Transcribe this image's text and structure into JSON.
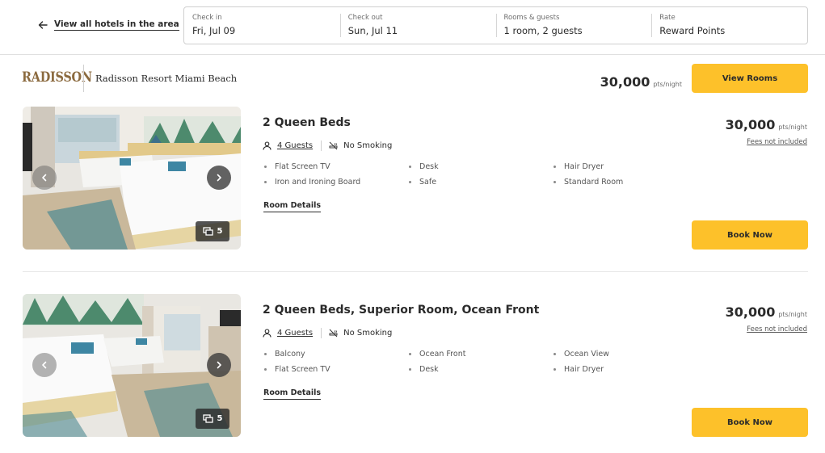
{
  "header": {
    "back_link": "View all hotels in the area",
    "search": [
      {
        "label": "Check in",
        "value": "Fri, Jul 09"
      },
      {
        "label": "Check out",
        "value": "Sun, Jul 11"
      },
      {
        "label": "Rooms & guests",
        "value": "1 room, 2 guests"
      },
      {
        "label": "Rate",
        "value": "Reward Points"
      }
    ]
  },
  "hotel": {
    "brand_logo": "RADISSON",
    "name": "Radisson Resort Miami Beach",
    "price": "30,000",
    "price_unit": "pts/night",
    "view_rooms_label": "View Rooms"
  },
  "rooms": [
    {
      "title": "2 Queen Beds",
      "guests": "4 Guests",
      "smoking": "No Smoking",
      "amenities": [
        "Flat Screen TV",
        "Desk",
        "Hair Dryer",
        "Iron and Ironing Board",
        "Safe",
        "Standard Room"
      ],
      "details_label": "Room Details",
      "price": "30,000",
      "price_unit": "pts/night",
      "fees_label": "Fees not included",
      "book_label": "Book Now",
      "photo_count": "5"
    },
    {
      "title": "2 Queen Beds, Superior Room, Ocean Front",
      "guests": "4 Guests",
      "smoking": "No Smoking",
      "amenities": [
        "Balcony",
        "Ocean Front",
        "Ocean View",
        "Flat Screen TV",
        "Desk",
        "Hair Dryer"
      ],
      "details_label": "Room Details",
      "price": "30,000",
      "price_unit": "pts/night",
      "fees_label": "Fees not included",
      "book_label": "Book Now",
      "photo_count": "5"
    }
  ],
  "colors": {
    "accent": "#fdc12a",
    "brand": "#8b6a3f"
  },
  "icons": [
    "arrow-left-icon",
    "person-icon",
    "no-smoking-icon",
    "chevron-left-icon",
    "chevron-right-icon",
    "photo-gallery-icon"
  ]
}
